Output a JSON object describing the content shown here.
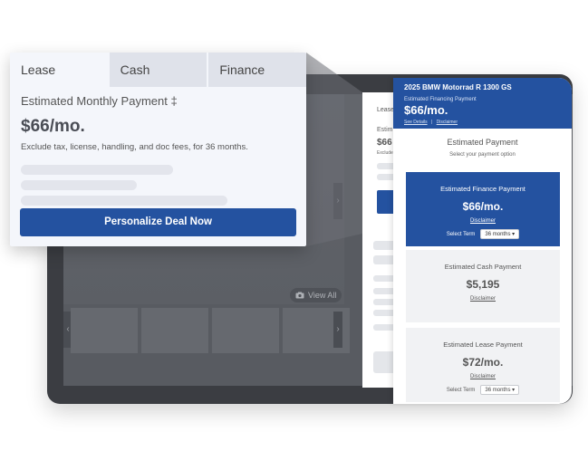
{
  "lease_card": {
    "tabs": [
      {
        "label": "Lease"
      },
      {
        "label": "Cash"
      },
      {
        "label": "Finance"
      }
    ],
    "estimate_label": "Estimated Monthly Payment ‡",
    "estimate_amount": "$66/mo.",
    "note": "Exclude tax, license, handling, and doc fees, for 36 months.",
    "cta_label": "Personalize Deal Now"
  },
  "gallery": {
    "view_all_label": "View All",
    "prev_icon": "chevron-left-icon",
    "next_icon": "chevron-right-icon"
  },
  "detail_panel": {
    "partial_tab": "Lease",
    "partial_label": "Estim",
    "partial_amount": "$66",
    "partial_note": "Exclude"
  },
  "payment_panel": {
    "vehicle_title": "2025 BMW Motorrad R 1300 GS",
    "header_label": "Estimated Financing Payment",
    "header_amount": "$66/mo.",
    "see_details": "See Details",
    "separator": "|",
    "disclaimer": "Disclaimer",
    "section_title": "Estimated Payment",
    "section_subtitle": "Select your payment option",
    "finance": {
      "label": "Estimated Finance Payment",
      "amount": "$66/mo.",
      "disclaimer": "Disclaimer",
      "term_label": "Select Term",
      "term_value": "36 months"
    },
    "cash": {
      "label": "Estimated Cash Payment",
      "amount": "$5,195",
      "disclaimer": "Disclaimer"
    },
    "lease": {
      "label": "Estimated Lease Payment",
      "amount": "$72/mo.",
      "disclaimer": "Disclaimer",
      "term_label": "Select Term",
      "term_value": "36 months"
    }
  },
  "colors": {
    "brand_blue": "#2452a0",
    "card_bg": "#f4f6fb",
    "tablet_frame": "#3b3d42"
  }
}
